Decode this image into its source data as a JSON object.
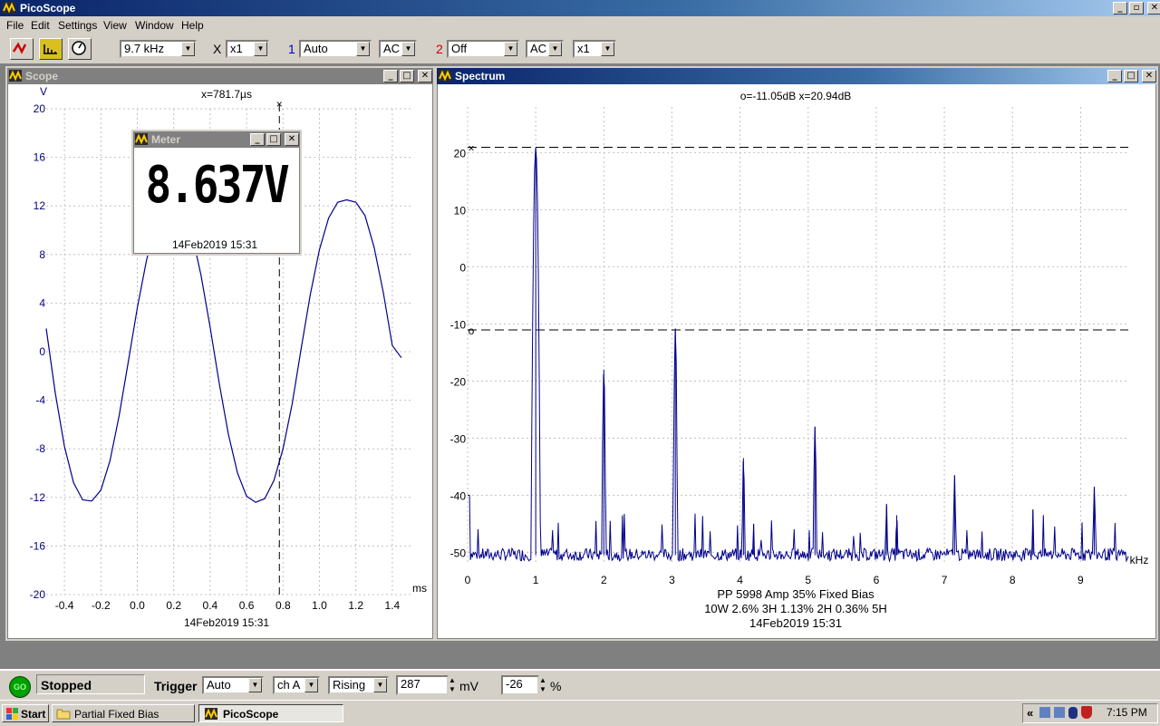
{
  "app": {
    "title": "PicoScope"
  },
  "menu": [
    "File",
    "Edit",
    "Settings",
    "View",
    "Window",
    "Help"
  ],
  "toolbar": {
    "timebase": "9.7 kHz",
    "x_label": "X",
    "zoom": "x1",
    "ch1_label": "1",
    "ch1_range": "Auto",
    "ch1_coupling": "AC",
    "ch2_label": "2",
    "ch2_range": "Off",
    "ch2_coupling": "AC",
    "ch2_mult": "x1"
  },
  "scope": {
    "title": "Scope",
    "readout": "x=781.7µs",
    "y_unit": "V",
    "x_unit": "ms",
    "timestamp": "14Feb2019  15:31"
  },
  "meter": {
    "title": "Meter",
    "value": "8.637V",
    "timestamp": "14Feb2019  15:31"
  },
  "spectrum": {
    "title": "Spectrum",
    "readout": "o=-11.05dB  x=20.94dB",
    "x_unit": "kHz",
    "caption1": "PP 5998 Amp 35% Fixed Bias",
    "caption2": "10W 2.6% 3H 1.13% 2H 0.36% 5H",
    "timestamp": "14Feb2019  15:31"
  },
  "status": {
    "go_label": "GO",
    "state": "Stopped",
    "trigger_label": "Trigger",
    "trigger_mode": "Auto",
    "trigger_channel": "ch A",
    "trigger_edge": "Rising",
    "trigger_level": "287",
    "level_unit": "mV",
    "pretrigger": "-26",
    "pretrigger_unit": "%"
  },
  "taskbar": {
    "start": "Start",
    "tasks": [
      "Partial Fixed Bias",
      "PicoScope"
    ],
    "clock": "7:15 PM",
    "tray_chevron": "«"
  },
  "colors": {
    "trace": "#00008b",
    "title_active": "#0a246a",
    "title_inactive": "#808080",
    "axis_text": "#000080"
  },
  "chart_data": [
    {
      "type": "line",
      "title": "",
      "xlabel": "ms",
      "ylabel": "V",
      "xlim": [
        -0.5,
        1.5
      ],
      "ylim": [
        -20,
        20
      ],
      "x_ticks": [
        -0.4,
        -0.2,
        0.0,
        0.2,
        0.4,
        0.6,
        0.8,
        1.0,
        1.2,
        1.4
      ],
      "x_tick_labels": [
        "-0.4",
        "-0.2",
        "0.0",
        "0.2",
        "0.4",
        "0.6",
        "0.8",
        "1.0",
        "1.2",
        "1.4"
      ],
      "y_ticks": [
        20,
        16,
        12,
        8,
        4,
        0,
        -4,
        -8,
        -12,
        -16,
        -20
      ],
      "y_tick_labels": [
        "20",
        "16",
        "12",
        "8",
        "4",
        "0",
        "-4",
        "-8",
        "-12",
        "-16",
        "-20"
      ],
      "series": [
        {
          "x": [
            -0.5,
            -0.45,
            -0.4,
            -0.35,
            -0.3,
            -0.25,
            -0.2,
            -0.15,
            -0.1,
            -0.05,
            0.0,
            0.05,
            0.1,
            0.15,
            0.2,
            0.25,
            0.3,
            0.35,
            0.4,
            0.45,
            0.5,
            0.55,
            0.6,
            0.65,
            0.7,
            0.75,
            0.8,
            0.85,
            0.9,
            0.95,
            1.0,
            1.05,
            1.1,
            1.15,
            1.2,
            1.25,
            1.3,
            1.35,
            1.4,
            1.45
          ],
          "y": [
            1.9,
            -3.4,
            -7.8,
            -10.8,
            -12.2,
            -12.3,
            -11.4,
            -9.0,
            -5.3,
            -0.9,
            3.6,
            7.5,
            10.4,
            12.0,
            12.3,
            11.7,
            9.7,
            6.3,
            2.0,
            -2.6,
            -6.8,
            -10.0,
            -11.9,
            -12.4,
            -12.1,
            -10.6,
            -8.0,
            -4.3,
            0.3,
            4.7,
            8.4,
            11.0,
            12.3,
            12.5,
            12.3,
            11.2,
            8.6,
            4.9,
            0.5,
            -0.5
          ]
        }
      ],
      "grid": true,
      "cursor_x": 0.78
    },
    {
      "type": "line",
      "title": "",
      "xlabel": "kHz",
      "ylabel": "",
      "xlim": [
        0,
        9.7
      ],
      "ylim": [
        -52,
        28
      ],
      "x_ticks": [
        0,
        1,
        2,
        3,
        4,
        5,
        6,
        7,
        8,
        9
      ],
      "x_tick_labels": [
        "0",
        "1",
        "2",
        "3",
        "4",
        "5",
        "6",
        "7",
        "8",
        "9"
      ],
      "y_ticks": [
        20,
        10,
        0,
        -10,
        -20,
        -30,
        -40,
        -50
      ],
      "y_tick_labels": [
        "20",
        "10",
        "0",
        "-10",
        "-20",
        "-30",
        "-40",
        "-50"
      ],
      "peaks": [
        {
          "x": 1.0,
          "y": 20.9
        },
        {
          "x": 2.0,
          "y": -18.0
        },
        {
          "x": 3.05,
          "y": -10.8
        },
        {
          "x": 4.05,
          "y": -33.5
        },
        {
          "x": 4.2,
          "y": -45.0
        },
        {
          "x": 5.1,
          "y": -28.0
        },
        {
          "x": 6.15,
          "y": -41.5
        },
        {
          "x": 6.3,
          "y": -43.5
        },
        {
          "x": 7.15,
          "y": -36.5
        },
        {
          "x": 8.3,
          "y": -42.5
        },
        {
          "x": 9.2,
          "y": -38.5
        }
      ],
      "noise_floor": -50.5,
      "marker_lines": [
        20.94,
        -11.05
      ],
      "grid": true
    }
  ]
}
